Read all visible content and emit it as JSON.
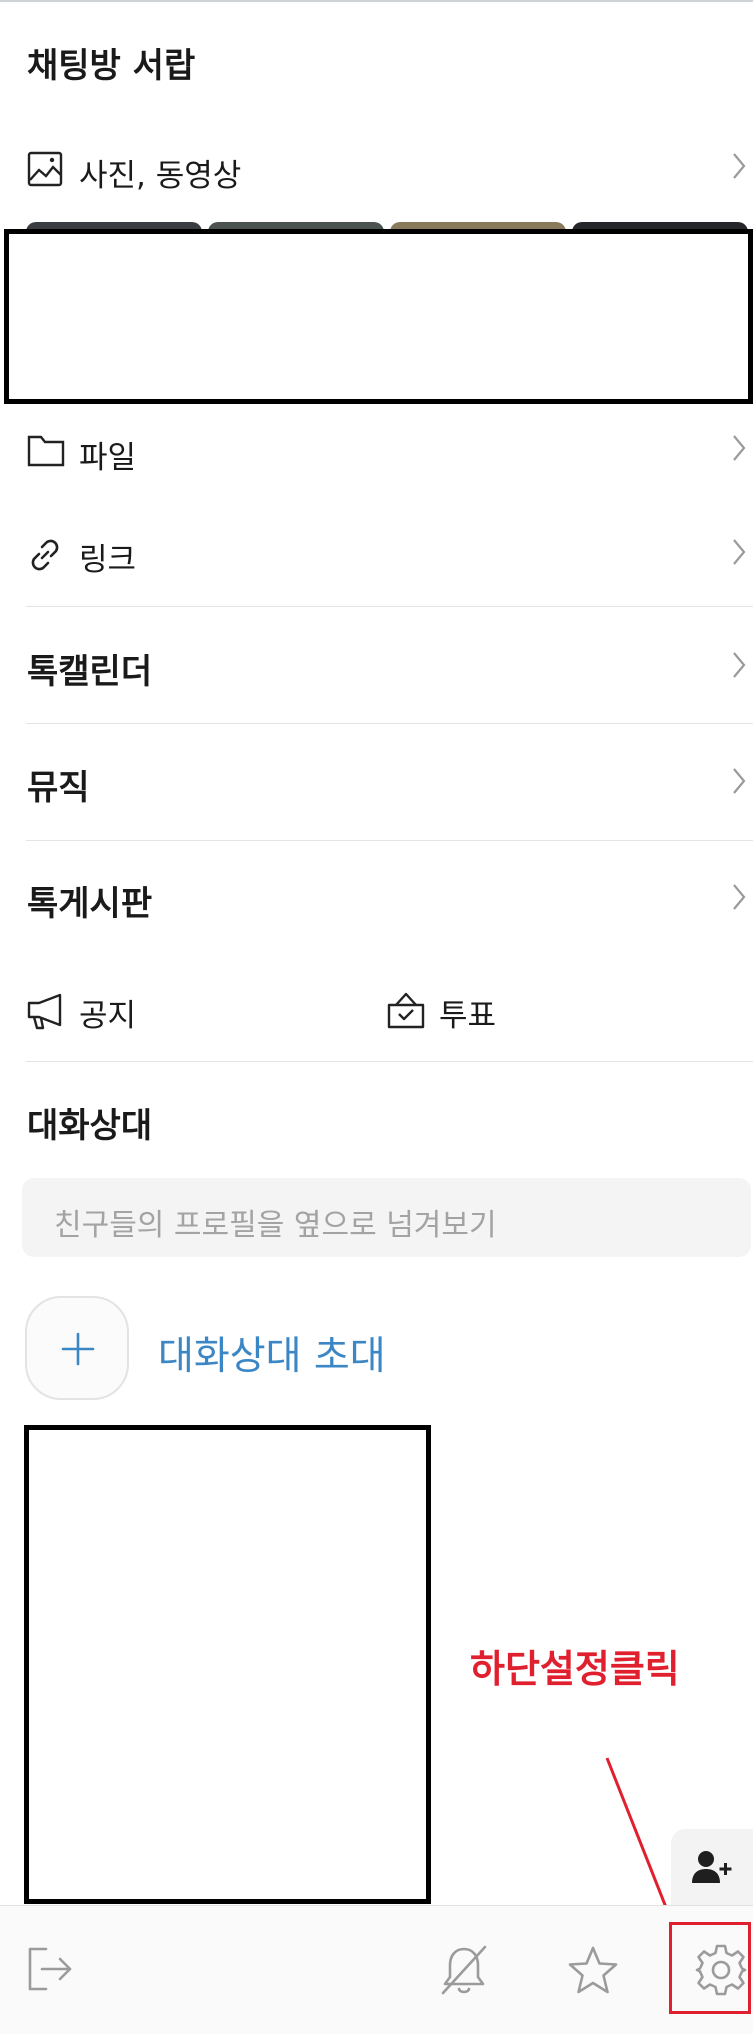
{
  "drawer": {
    "title": "채팅방 서랍",
    "media": {
      "label": "사진, 동영상",
      "icon": "image-icon"
    },
    "files": {
      "label": "파일",
      "icon": "folder-icon"
    },
    "links": {
      "label": "링크",
      "icon": "link-icon"
    },
    "sections": {
      "calendar": "톡캘린더",
      "music": "뮤직",
      "board": "톡게시판"
    },
    "notice": {
      "label": "공지",
      "icon": "megaphone-icon"
    },
    "poll": {
      "label": "투표",
      "icon": "ballot-box-icon"
    }
  },
  "members": {
    "title": "대화상대",
    "search_placeholder": "친구들의 프로필을 옆으로 넘겨보기",
    "invite_label": "대화상대 초대"
  },
  "annotation": {
    "text": "하단설정클릭",
    "color": "#e0202f"
  },
  "bottom_bar": {
    "icons": [
      "exit-icon",
      "bell-off-icon",
      "star-icon",
      "gear-icon"
    ]
  },
  "colors": {
    "accent_blue": "#3b86c4",
    "annotation_red": "#e0202f"
  }
}
